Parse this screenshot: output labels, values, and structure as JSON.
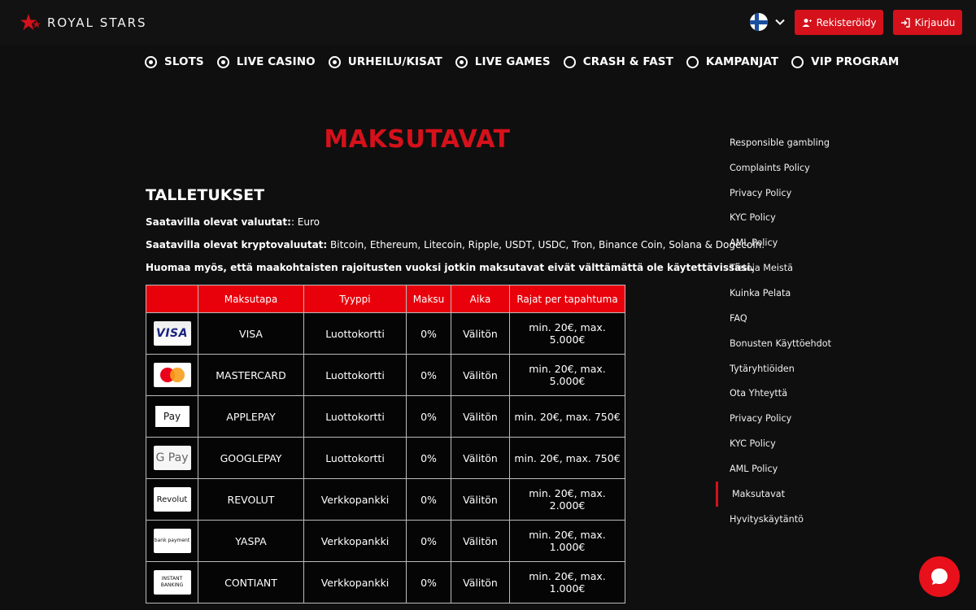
{
  "header": {
    "logo_text": "ROYAL STARS",
    "language_flag": "finland-flag",
    "register_label": "Rekisteröidy",
    "login_label": "Kirjaudu"
  },
  "nav": [
    {
      "label": "SLOTS",
      "icon": "slots-icon"
    },
    {
      "label": "LIVE CASINO",
      "icon": "live-casino-icon"
    },
    {
      "label": "URHEILU/KISAT",
      "icon": "sports-icon"
    },
    {
      "label": "LIVE GAMES",
      "icon": "live-games-icon"
    },
    {
      "label": "CRASH & FAST",
      "icon": "rocket-icon"
    },
    {
      "label": "KAMPANJAT",
      "icon": "gift-icon"
    },
    {
      "label": "VIP PROGRAM",
      "icon": "crown-icon"
    }
  ],
  "main": {
    "title": "MAKSUTAVAT",
    "section_title": "TALLETUKSET",
    "currencies_label": "Saatavilla olevat valuutat:",
    "currencies_value": ": Euro",
    "crypto_label": "Saatavilla olevat kryptovaluutat:",
    "crypto_value": " Bitcoin, Ethereum, Litecoin, Ripple, USDT, USDC, Tron, Binance Coin, Solana & Dogecoin.",
    "notice": "Huomaa myös, että maakohtaisten rajoitusten vuoksi jotkin maksutavat eivät välttämättä ole käytettävissäsi."
  },
  "table": {
    "headers": [
      "",
      "Maksutapa",
      "Tyyppi",
      "Maksu",
      "Aika",
      "Rajat per tapahtuma"
    ],
    "rows": [
      {
        "logo": "visa-logo",
        "logo_text": "VISA",
        "name": "VISA",
        "type": "Luottokortti",
        "fee": "0%",
        "time": "Välitön",
        "limits": "min. 20€, max. 5.000€"
      },
      {
        "logo": "mastercard-logo",
        "logo_text": "",
        "name": "MASTERCARD",
        "type": "Luottokortti",
        "fee": "0%",
        "time": "Välitön",
        "limits": "min. 20€, max. 5.000€"
      },
      {
        "logo": "applepay-logo",
        "logo_text": " Pay",
        "name": "APPLEPAY",
        "type": "Luottokortti",
        "fee": "0%",
        "time": "Välitön",
        "limits": "min. 20€, max. 750€"
      },
      {
        "logo": "googlepay-logo",
        "logo_text": "G Pay",
        "name": "GOOGLEPAY",
        "type": "Luottokortti",
        "fee": "0%",
        "time": "Välitön",
        "limits": "min. 20€, max. 750€"
      },
      {
        "logo": "revolut-logo",
        "logo_text": "Revolut",
        "name": "REVOLUT",
        "type": "Verkkopankki",
        "fee": "0%",
        "time": "Välitön",
        "limits": "min. 20€, max. 2.000€"
      },
      {
        "logo": "yaspa-logo",
        "logo_text": "bank payment",
        "name": "YASPA",
        "type": "Verkkopankki",
        "fee": "0%",
        "time": "Välitön",
        "limits": "min. 20€, max. 1.000€"
      },
      {
        "logo": "contiant-logo",
        "logo_text": "INSTANT BANKING",
        "name": "CONTIANT",
        "type": "Verkkopankki",
        "fee": "0%",
        "time": "Välitön",
        "limits": "min. 20€, max. 1.000€"
      }
    ]
  },
  "sidebar": {
    "items": [
      "Responsible gambling",
      "Complaints Policy",
      "Privacy Policy",
      "KYC Policy",
      "AML Policy",
      "Tietoja Meistä",
      "Kuinka Pelata",
      "FAQ",
      "Bonusten Käyttöehdot",
      "Tytäryhtiöiden",
      "Ota Yhteyttä",
      "Privacy Policy",
      "KYC Policy",
      "AML Policy",
      "Maksutavat",
      "Hyvityskäytäntö"
    ],
    "active": "Maksutavat"
  },
  "colors": {
    "accent": "#d5111b",
    "background": "#0f0f0f",
    "table_header": "#e8000b"
  }
}
